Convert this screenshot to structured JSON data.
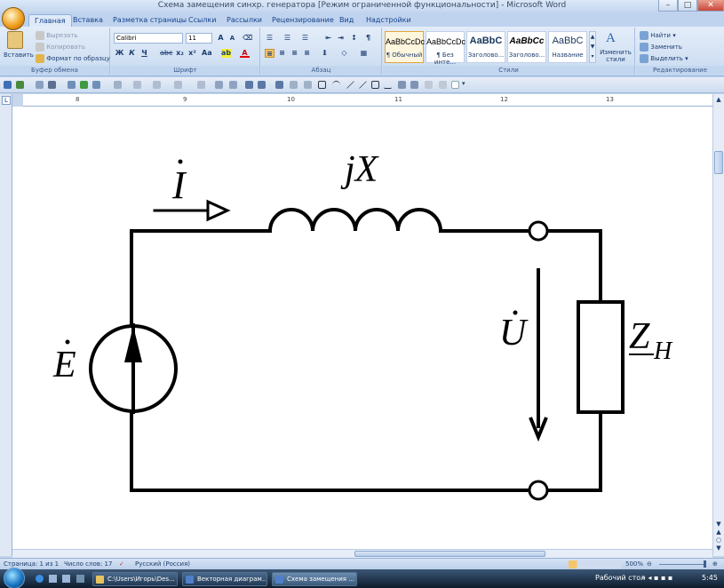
{
  "window": {
    "title": "Схема замещения синхр. генератора [Режим ограниченной функциональности] - Microsoft Word"
  },
  "tabs": [
    "Главная",
    "Вставка",
    "Разметка страницы",
    "Ссылки",
    "Рассылки",
    "Рецензирование",
    "Вид",
    "Надстройки"
  ],
  "ribbon": {
    "clipboard": {
      "paste": "Вставить",
      "cut": "Вырезать",
      "copy": "Копировать",
      "format_painter": "Формат по образцу",
      "label": "Буфер обмена"
    },
    "font": {
      "name": "Calibri",
      "size": "11",
      "label": "Шрифт"
    },
    "paragraph": {
      "label": "Абзац"
    },
    "styles": {
      "items": [
        {
          "sample": "AaBbCcDc",
          "name": "¶ Обычный"
        },
        {
          "sample": "AaBbCcDc",
          "name": "¶ Без инте..."
        },
        {
          "sample": "AaBbC",
          "name": "Заголово..."
        },
        {
          "sample": "AaBbCc",
          "name": "Заголово..."
        },
        {
          "sample": "AaBbC",
          "name": "Название"
        }
      ],
      "change_styles": "Изменить стили",
      "label": "Стили"
    },
    "editing": {
      "find": "Найти",
      "replace": "Заменить",
      "select": "Выделить",
      "label": "Редактирование"
    }
  },
  "ruler": {
    "ticks": [
      "8",
      "9",
      "10",
      "11",
      "12",
      "13"
    ]
  },
  "circuit": {
    "current_label": "I",
    "reactance_label": "jX",
    "emf_label": "E",
    "voltage_label": "U",
    "load_label": "Z",
    "load_subscript": "H"
  },
  "statusbar": {
    "page": "Страница: 1 из 1",
    "words": "Число слов: 17",
    "language": "Русский (Россия)",
    "zoom": "500%"
  },
  "taskbar": {
    "buttons": [
      "C:\\Users\\Игорь\\Des...",
      "Векторная диаграм...",
      "Схема замещения ..."
    ],
    "desktop": "Рабочий стол",
    "time": "5:45"
  },
  "colors": {
    "accent": "#15428b",
    "ribbon": "#dbe7f6",
    "ink": "#000000"
  }
}
